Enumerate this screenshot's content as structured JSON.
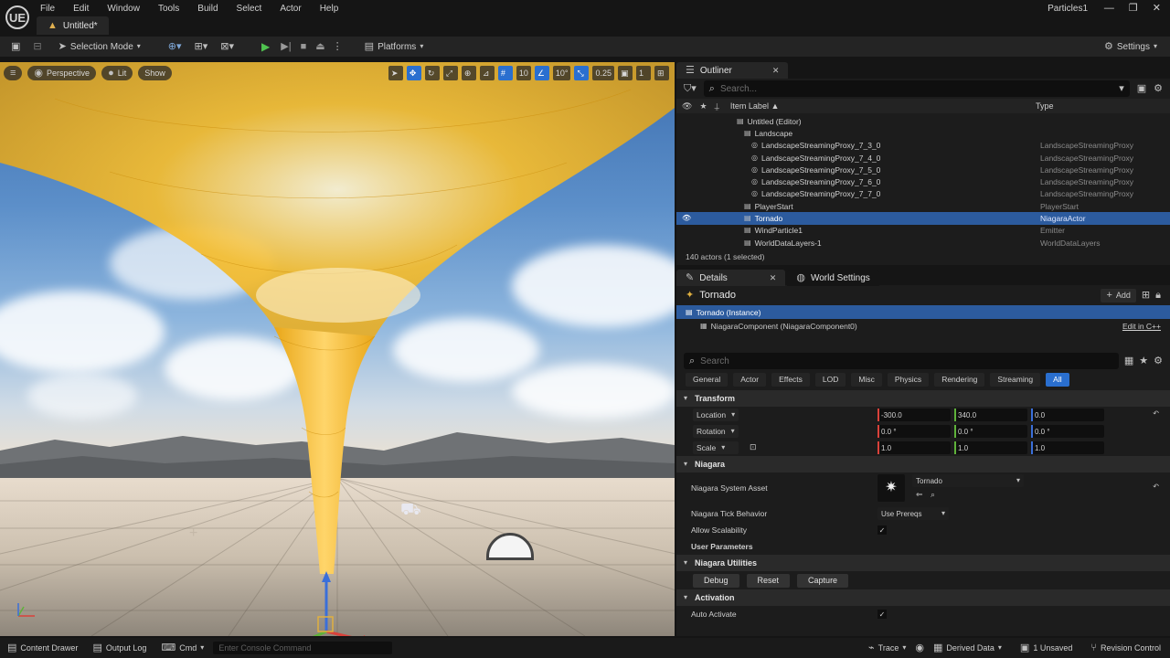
{
  "titlebar": {
    "logo": "UE",
    "menu": [
      "File",
      "Edit",
      "Window",
      "Tools",
      "Build",
      "Select",
      "Actor",
      "Help"
    ],
    "doc_tab": "Untitled*",
    "project": "Particles1"
  },
  "toolbar": {
    "mode": "Selection Mode",
    "platforms": "Platforms",
    "settings": "Settings"
  },
  "viewport": {
    "perspective": "Perspective",
    "lit": "Lit",
    "show": "Show",
    "grid_snap": "10",
    "rot_snap": "10°",
    "scale_snap": "0.25",
    "cam_speed": "1"
  },
  "outliner": {
    "tab": "Outliner",
    "search_placeholder": "Search...",
    "col_label": "Item Label ▲",
    "col_type": "Type",
    "rows": [
      {
        "label": "Untitled (Editor)",
        "type": "",
        "indent": 66
      },
      {
        "label": "Landscape",
        "type": "",
        "indent": 74
      },
      {
        "label": "LandscapeStreamingProxy_7_3_0",
        "type": "LandscapeStreamingProxy",
        "indent": 82
      },
      {
        "label": "LandscapeStreamingProxy_7_4_0",
        "type": "LandscapeStreamingProxy",
        "indent": 82
      },
      {
        "label": "LandscapeStreamingProxy_7_5_0",
        "type": "LandscapeStreamingProxy",
        "indent": 82
      },
      {
        "label": "LandscapeStreamingProxy_7_6_0",
        "type": "LandscapeStreamingProxy",
        "indent": 82
      },
      {
        "label": "LandscapeStreamingProxy_7_7_0",
        "type": "LandscapeStreamingProxy",
        "indent": 82
      },
      {
        "label": "PlayerStart",
        "type": "PlayerStart",
        "indent": 74
      },
      {
        "label": "Tornado",
        "type": "NiagaraActor",
        "indent": 74
      },
      {
        "label": "WindParticle1",
        "type": "Emitter",
        "indent": 74
      },
      {
        "label": "WorldDataLayers-1",
        "type": "WorldDataLayers",
        "indent": 74
      }
    ],
    "selected_index": 8,
    "footer": "140 actors (1 selected)"
  },
  "details": {
    "tab_details": "Details",
    "tab_world": "World Settings",
    "actor_name": "Tornado",
    "add_btn": "Add",
    "instance": "Tornado (Instance)",
    "component": "NiagaraComponent (NiagaraComponent0)",
    "edit_cpp": "Edit in C++",
    "search_placeholder": "Search",
    "filters": [
      "General",
      "Actor",
      "Effects",
      "LOD",
      "Misc",
      "Physics",
      "Rendering",
      "Streaming",
      "All"
    ],
    "transform": {
      "category": "Transform",
      "location_label": "Location",
      "rotation_label": "Rotation",
      "scale_label": "Scale",
      "loc_x": "-300.0",
      "loc_y": "340.0",
      "loc_z": "0.0",
      "rot_x": "0.0 °",
      "rot_y": "0.0 °",
      "rot_z": "0.0 °",
      "scale_x": "1.0",
      "scale_y": "1.0",
      "scale_z": "1.0"
    },
    "niagara": {
      "category": "Niagara",
      "asset_label": "Niagara System Asset",
      "asset_value": "Tornado",
      "tick_label": "Niagara Tick Behavior",
      "tick_value": "Use Prereqs",
      "scalability_label": "Allow Scalability",
      "user_params": "User Parameters"
    },
    "utilities": {
      "category": "Niagara Utilities",
      "debug": "Debug",
      "reset": "Reset",
      "capture": "Capture"
    },
    "activation": {
      "category": "Activation",
      "auto_label": "Auto Activate"
    }
  },
  "statusbar": {
    "content_drawer": "Content Drawer",
    "output_log": "Output Log",
    "cmd": "Cmd",
    "console_placeholder": "Enter Console Command",
    "trace": "Trace",
    "derived_data": "Derived Data",
    "unsaved": "1 Unsaved",
    "revision": "Revision Control"
  },
  "colors": {
    "accent": "#2a6fcf",
    "play": "#4fc24f",
    "tornado": "#f2b21c",
    "axis_x": "#d9413a",
    "axis_y": "#5fb23a",
    "axis_z": "#3a6fd9"
  }
}
